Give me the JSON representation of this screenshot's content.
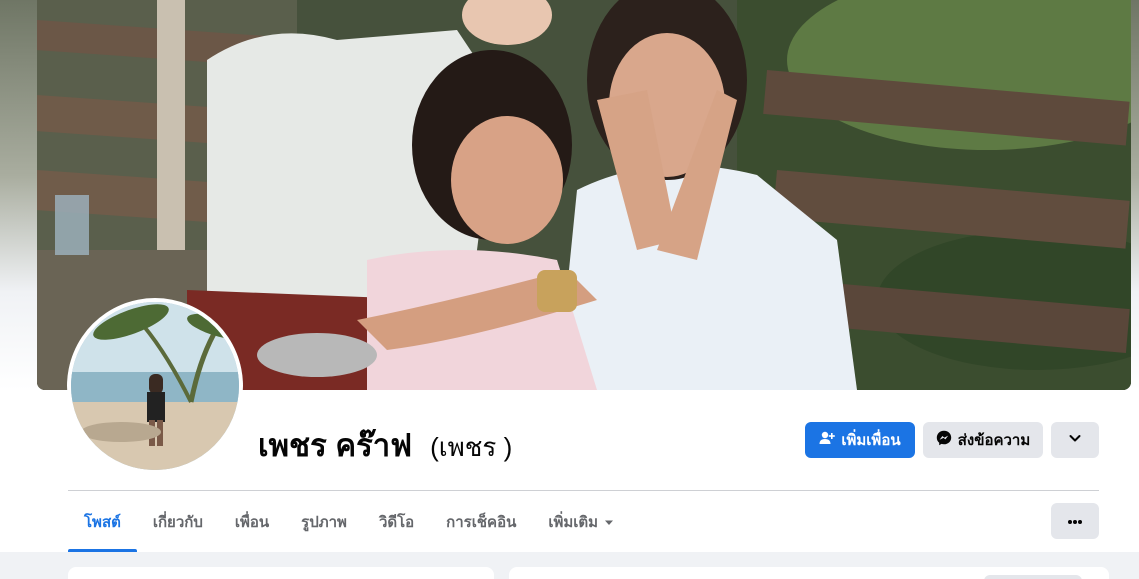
{
  "profile": {
    "name": "เพชร คร๊าฟ",
    "alternate_name": "(เพชร )"
  },
  "actions": {
    "add_friend_label": "เพิ่มเพื่อน",
    "message_label": "ส่งข้อความ",
    "more_icon": "chevron-down-icon"
  },
  "tabs": [
    {
      "label": "โพสต์",
      "active": true
    },
    {
      "label": "เกี่ยวกับ"
    },
    {
      "label": "เพื่อน"
    },
    {
      "label": "รูปภาพ"
    },
    {
      "label": "วิดีโอ"
    },
    {
      "label": "การเช็คอิน"
    },
    {
      "label": "เพิ่มเติม",
      "icon": "caret-down-icon"
    }
  ],
  "colors": {
    "primary": "#1b74e4",
    "secondary_button": "#e4e6eb",
    "text": "#050505",
    "muted_text": "#65676b",
    "page_bg": "#f0f2f5"
  }
}
